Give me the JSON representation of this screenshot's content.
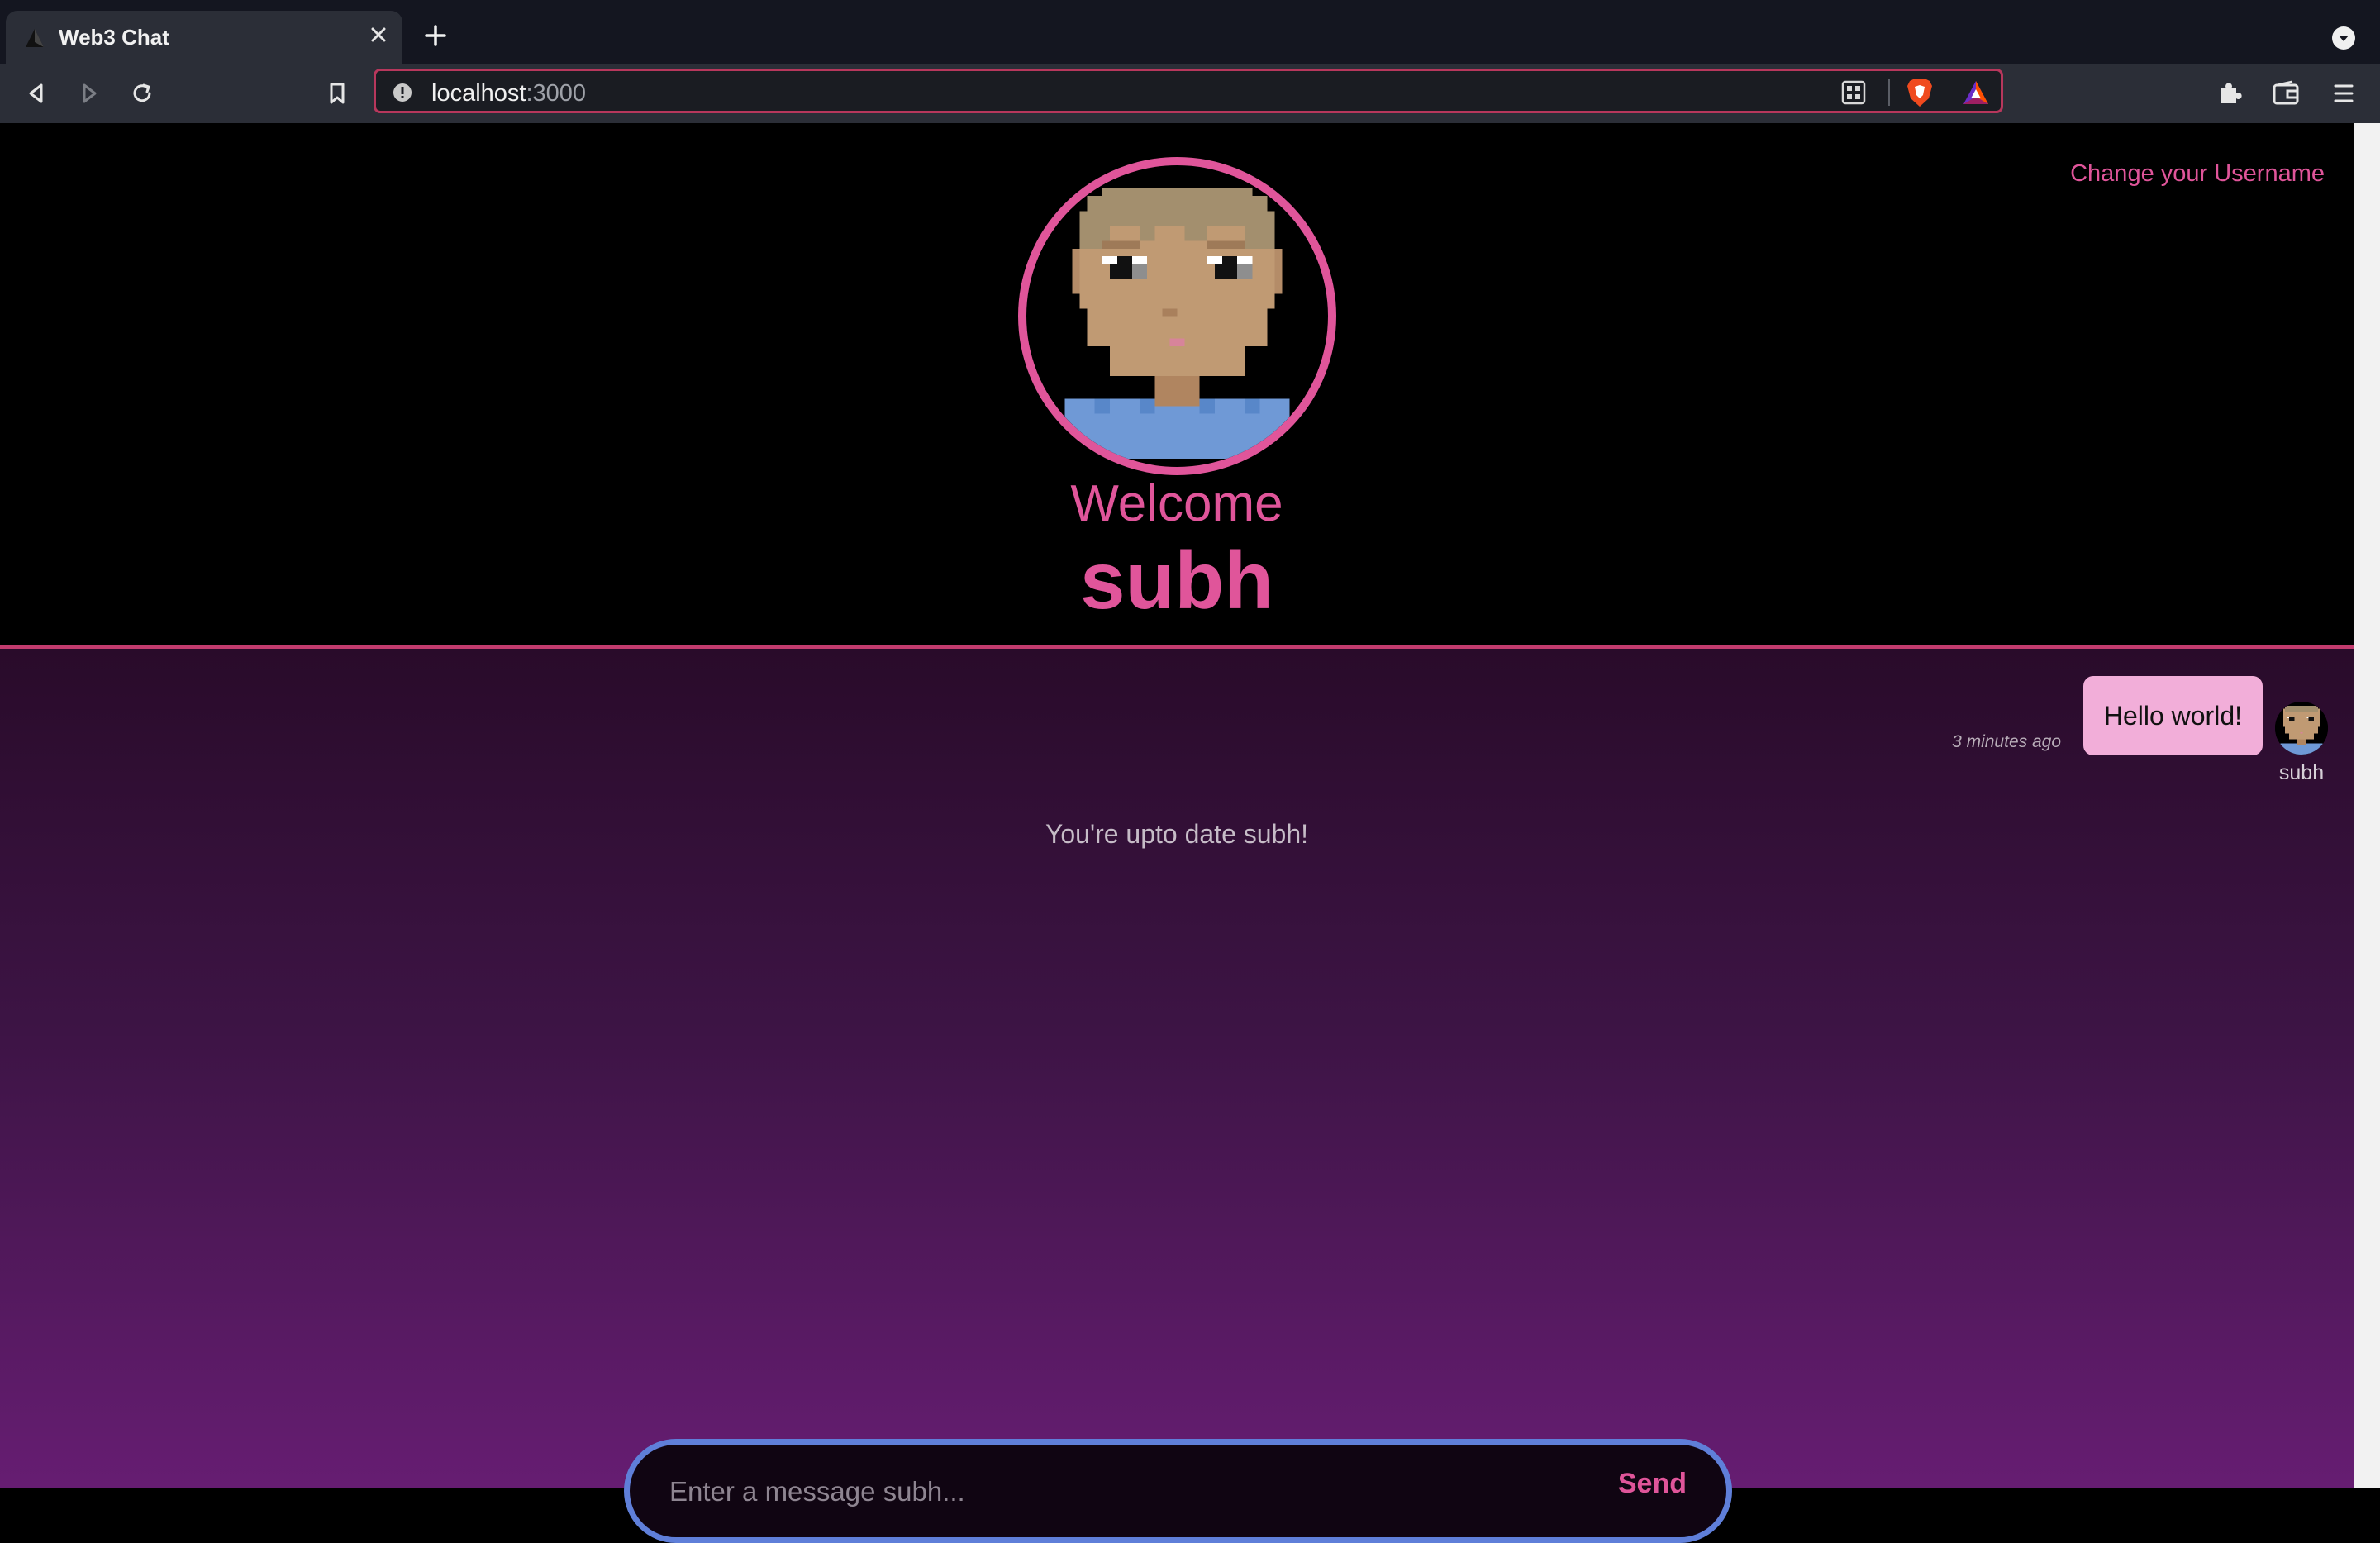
{
  "browser": {
    "tab_title": "Web3 Chat",
    "url_host": "localhost",
    "url_port": ":3000"
  },
  "header": {
    "change_username_label": "Change your Username",
    "welcome_text": "Welcome",
    "username": "subh"
  },
  "messages": [
    {
      "text": "Hello world!",
      "time": "3 minutes ago",
      "user": "subh"
    }
  ],
  "status_text": "You're upto date subh!",
  "composer": {
    "placeholder": "Enter a message subh...",
    "send_label": "Send"
  },
  "colors": {
    "accent": "#e0559a",
    "bubble": "#f2aed9",
    "composer_border": "#5f7fd9",
    "url_border": "#b7375c"
  }
}
